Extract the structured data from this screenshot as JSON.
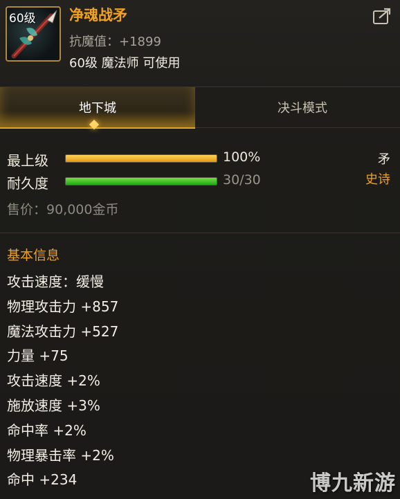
{
  "item": {
    "level_badge": "60级",
    "name": "净魂战矛",
    "resistance": "抗魔值：+1899",
    "requirement": "60级 魔法师 可使用"
  },
  "tabs": [
    {
      "label": "地下城",
      "active": true
    },
    {
      "label": "决斗模式",
      "active": false
    }
  ],
  "bars": {
    "grade": {
      "label": "最上级",
      "value_text": "100%",
      "fraction": 1.0
    },
    "durability": {
      "label": "耐久度",
      "value_text": "30/30",
      "fraction": 1.0
    }
  },
  "type": "矛",
  "rarity": "史诗",
  "price": "售价：90,000金币",
  "stats": {
    "title": "基本信息",
    "lines": [
      "攻击速度：缓慢",
      "物理攻击力 +857",
      "魔法攻击力 +527",
      "力量 +75",
      "攻击速度 +2%",
      "施放速度 +3%",
      "命中率 +2%",
      "物理暴击率 +2%",
      "命中 +234"
    ]
  },
  "colors": {
    "accent_gold": "#f0a21e",
    "bar_gold": "#e39a12",
    "bar_green": "#22a41a",
    "tab_active": "#e0a82a"
  },
  "icons": [
    "spear-item-icon",
    "share-icon",
    "tab-marker-diamond"
  ],
  "watermark": "博九新游"
}
